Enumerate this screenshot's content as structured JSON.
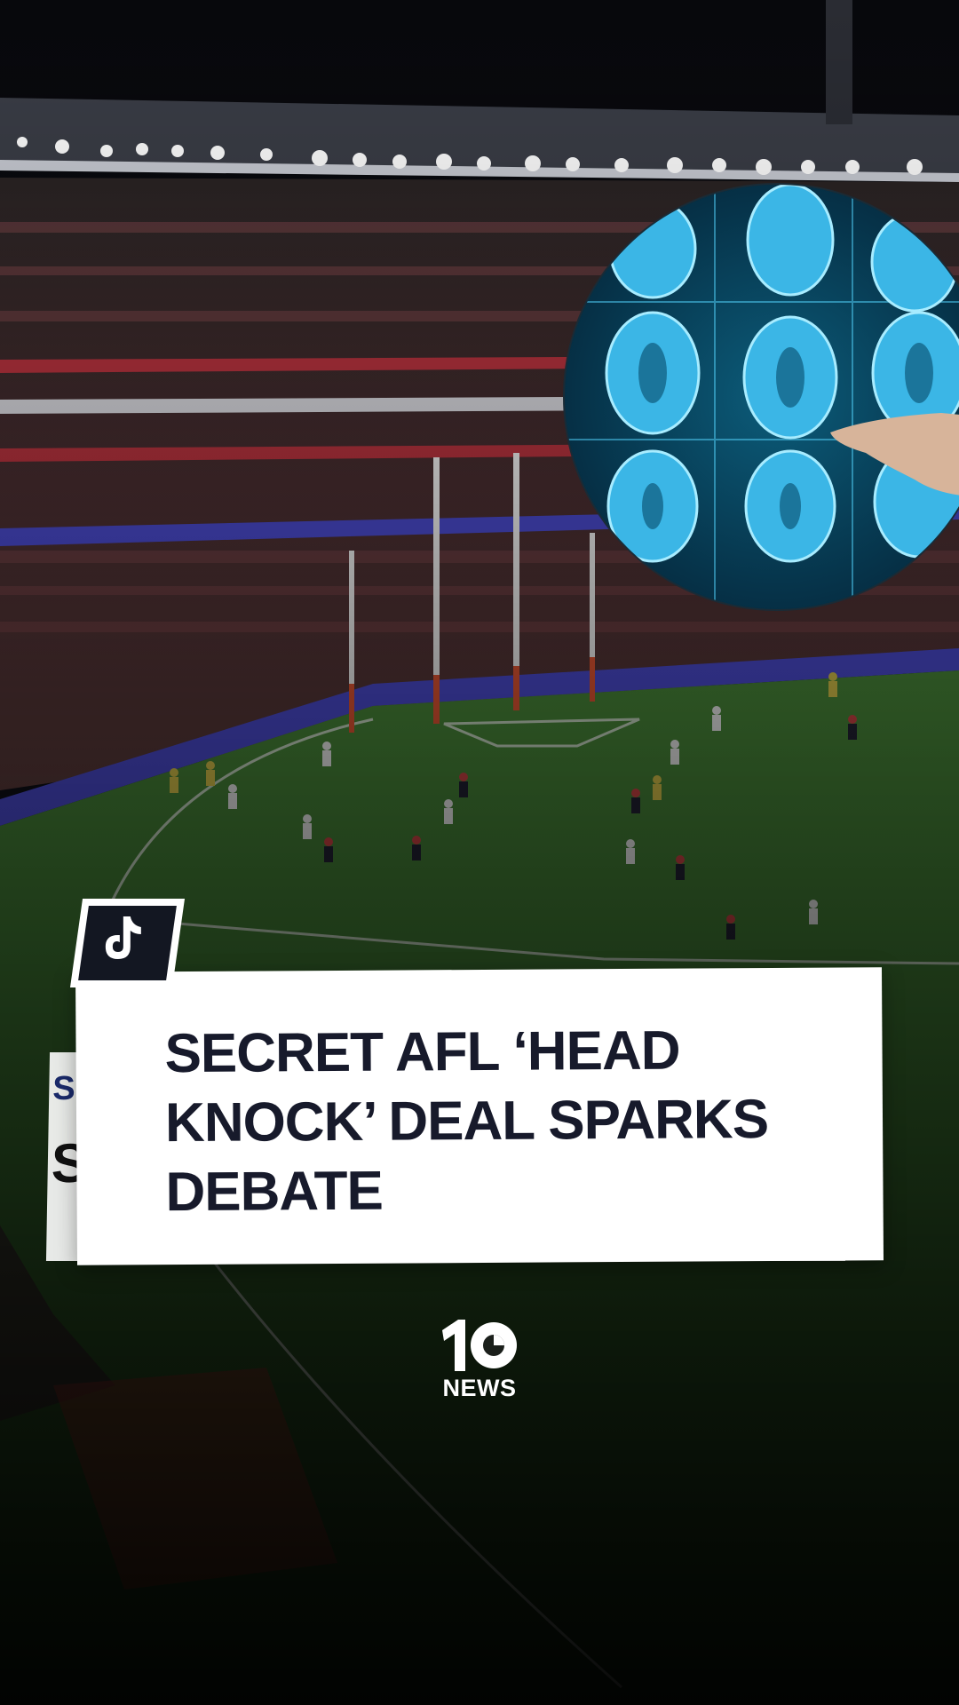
{
  "video": {
    "headline": "SECRET AFL ‘HEAD KNOCK’ DEAL SPARKS DEBATE",
    "ghost_caption_start": "S",
    "ghost_caption_big": "S"
  },
  "platform": {
    "icon": "tiktok-icon"
  },
  "broadcaster": {
    "logo_number": "10",
    "logo_word": "NEWS"
  },
  "colors": {
    "card_background": "#ffffff",
    "headline_text": "#171a2b",
    "badge_dark": "#131722",
    "brain_scan": "#36c2e8",
    "pitch_green": "#3d7a2e",
    "signage_blue": "#4b4bd0"
  }
}
